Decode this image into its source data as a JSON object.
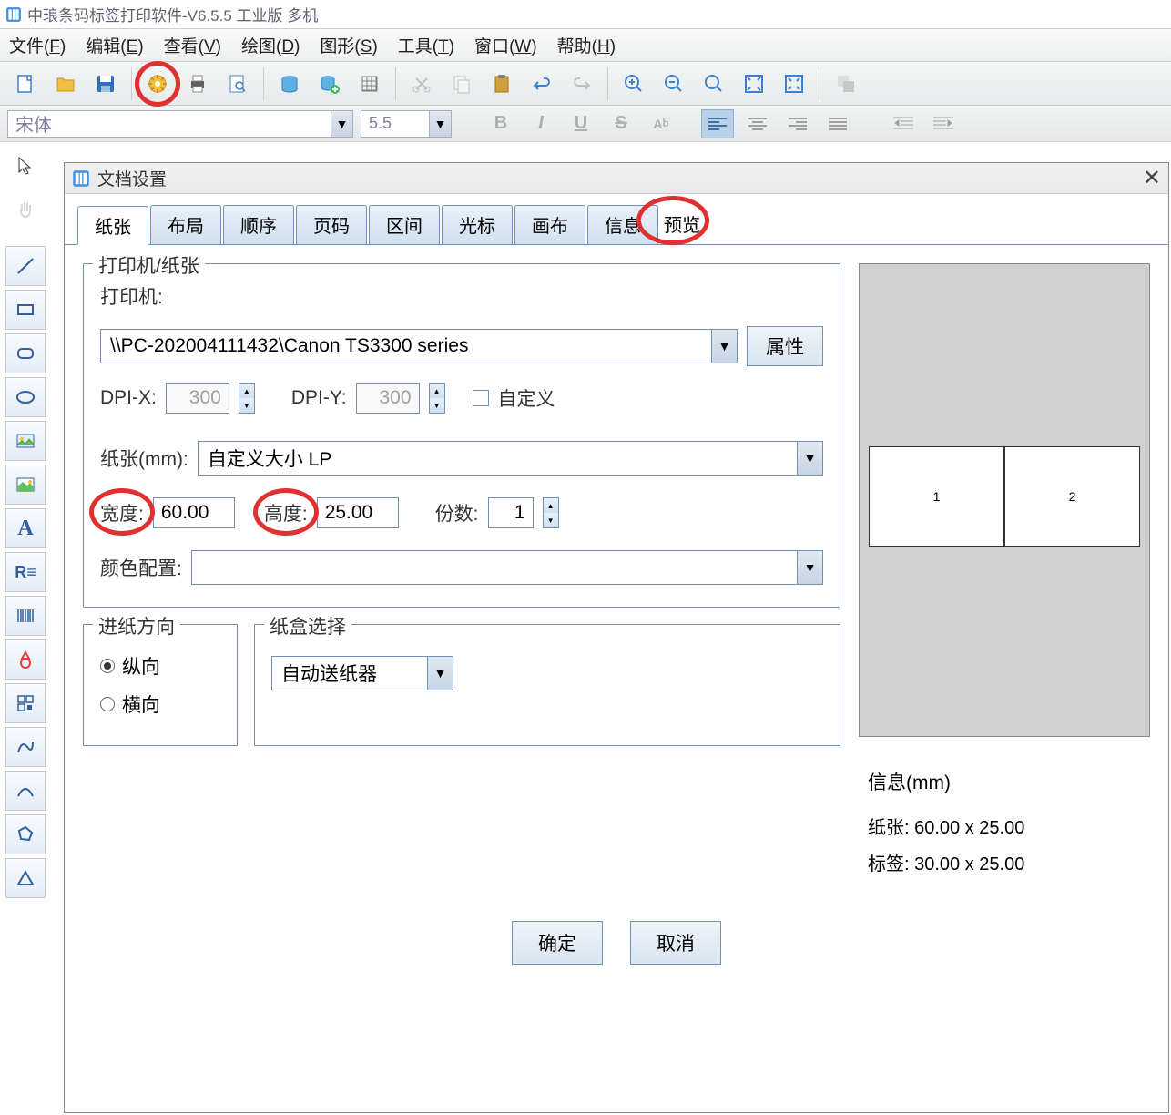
{
  "app": {
    "title": "中琅条码标签打印软件-V6.5.5 工业版 多机"
  },
  "menu": {
    "file": "文件",
    "file_key": "F",
    "edit": "编辑",
    "edit_key": "E",
    "view": "查看",
    "view_key": "V",
    "draw": "绘图",
    "draw_key": "D",
    "shape": "图形",
    "shape_key": "S",
    "tool": "工具",
    "tool_key": "T",
    "window": "窗口",
    "window_key": "W",
    "help": "帮助",
    "help_key": "H"
  },
  "formatbar": {
    "font": "宋体",
    "size": "5.5"
  },
  "dialog": {
    "title": "文档设置",
    "tabs": [
      "纸张",
      "布局",
      "顺序",
      "页码",
      "区间",
      "光标",
      "画布",
      "信息"
    ],
    "preview_tab": "预览",
    "printer_paper_legend": "打印机/纸张",
    "printer_label": "打印机:",
    "printer_value": "\\\\PC-202004111432\\Canon TS3300 series",
    "properties_btn": "属性",
    "dpi_x_label": "DPI-X:",
    "dpi_x_value": "300",
    "dpi_y_label": "DPI-Y:",
    "dpi_y_value": "300",
    "custom_label": "自定义",
    "paper_label": "纸张(mm):",
    "paper_value": "自定义大小 LP",
    "width_label": "宽度:",
    "width_value": "60.00",
    "height_label": "高度:",
    "height_value": "25.00",
    "copies_label": "份数:",
    "copies_value": "1",
    "color_config_label": "颜色配置:",
    "feed_direction_legend": "进纸方向",
    "portrait": "纵向",
    "landscape": "横向",
    "tray_legend": "纸盒选择",
    "tray_value": "自动送纸器",
    "info_title": "信息(mm)",
    "info_paper": "纸张: 60.00 x 25.00",
    "info_label": "标签: 30.00 x 25.00",
    "ok_btn": "确定",
    "cancel_btn": "取消",
    "preview_1": "1",
    "preview_2": "2"
  }
}
